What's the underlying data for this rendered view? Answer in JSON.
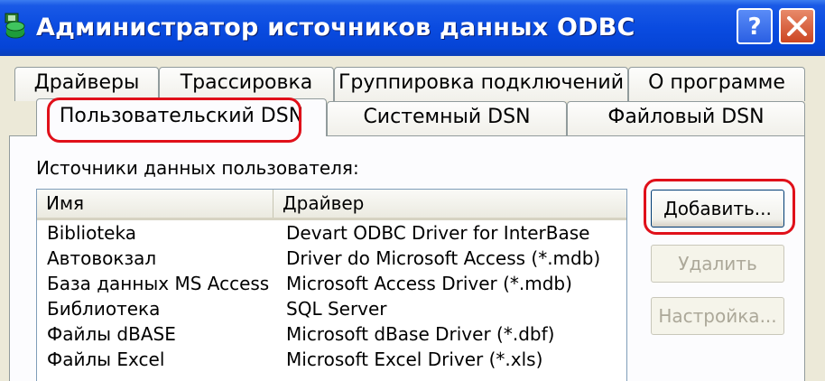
{
  "window": {
    "title": "Администратор источников данных ODBC",
    "help_label": "?",
    "accent_color": "#0a4be0",
    "annotation_color": "#e0101a"
  },
  "tabs": {
    "back_row": [
      "Драйверы",
      "Трассировка",
      "Группировка подключений",
      "О программе"
    ],
    "front_row": [
      "Пользовательский DSN",
      "Системный DSN",
      "Файловый DSN"
    ],
    "active": "Пользовательский DSN"
  },
  "group_label": "Источники данных пользователя:",
  "list": {
    "columns": [
      "Имя",
      "Драйвер"
    ],
    "rows": [
      [
        "Biblioteka",
        "Devart ODBC Driver for InterBase"
      ],
      [
        "Автовокзал",
        "Driver do Microsoft Access (*.mdb)"
      ],
      [
        "База данных MS Access",
        "Microsoft Access Driver (*.mdb)"
      ],
      [
        "Библиотека",
        "SQL Server"
      ],
      [
        "Файлы dBASE",
        "Microsoft dBase Driver (*.dbf)"
      ],
      [
        "Файлы Excel",
        "Microsoft Excel Driver (*.xls)"
      ]
    ]
  },
  "buttons": {
    "add": "Добавить...",
    "remove": "Удалить",
    "configure": "Настройка..."
  }
}
